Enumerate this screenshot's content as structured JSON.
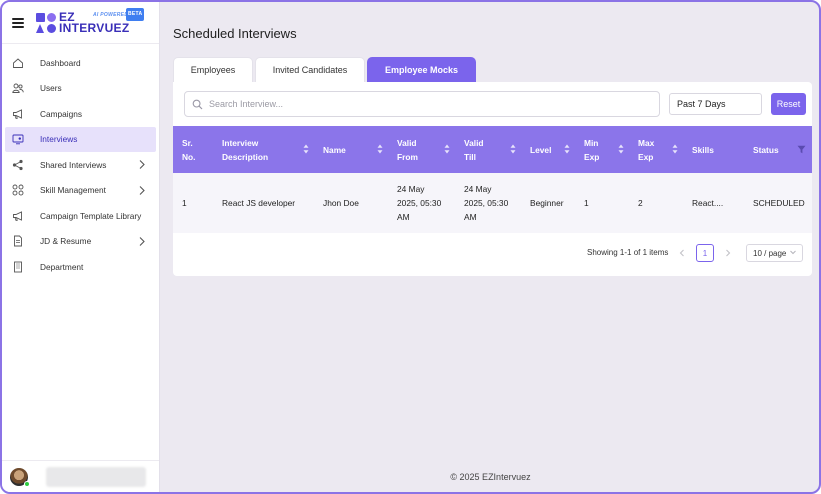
{
  "brand": {
    "line1": "EZ",
    "line2": "INTERVUEZ",
    "tagline": "AI POWERED",
    "badge": "BETA",
    "color": "#3a2fb8"
  },
  "sidebar": {
    "items": [
      {
        "label": "Dashboard",
        "icon": "home-icon"
      },
      {
        "label": "Users",
        "icon": "users-icon"
      },
      {
        "label": "Campaigns",
        "icon": "megaphone-icon"
      },
      {
        "label": "Interviews",
        "icon": "monitor-user-icon",
        "active": true
      },
      {
        "label": "Shared Interviews",
        "icon": "share-icon",
        "expandable": true
      },
      {
        "label": "Skill Management",
        "icon": "apps-icon",
        "expandable": true
      },
      {
        "label": "Campaign Template Library",
        "icon": "megaphone-icon"
      },
      {
        "label": "JD & Resume",
        "icon": "document-icon",
        "expandable": true
      },
      {
        "label": "Department",
        "icon": "building-icon"
      }
    ]
  },
  "page": {
    "title": "Scheduled Interviews"
  },
  "tabs": [
    {
      "label": "Employees"
    },
    {
      "label": "Invited Candidates"
    },
    {
      "label": "Employee Mocks",
      "active": true
    }
  ],
  "filters": {
    "search_placeholder": "Search Interview...",
    "date_range": "Past 7 Days",
    "reset_label": "Reset"
  },
  "table": {
    "columns": [
      {
        "label": "Sr.\nNo.",
        "sortable": false
      },
      {
        "label": "Interview\nDescription",
        "sortable": true
      },
      {
        "label": "Name",
        "sortable": true
      },
      {
        "label": "Valid\nFrom",
        "sortable": true
      },
      {
        "label": "Valid\nTill",
        "sortable": true
      },
      {
        "label": "Level",
        "sortable": true
      },
      {
        "label": "Min\nExp",
        "sortable": true
      },
      {
        "label": "Max\nExp",
        "sortable": true
      },
      {
        "label": "Skills",
        "sortable": false
      },
      {
        "label": "Status",
        "filter": true
      }
    ],
    "rows": [
      [
        "1",
        "React JS developer",
        "Jhon Doe",
        "24 May\n2025, 05:30\nAM",
        "24 May\n2025, 05:30\nAM",
        "Beginner",
        "1",
        "2",
        "React....",
        "SCHEDULED"
      ]
    ]
  },
  "pagination": {
    "summary": "Showing 1-1 of 1 items",
    "current_page": "1",
    "page_size": "10 / page"
  },
  "footer": {
    "copyright": "© 2025 EZIntervuez"
  },
  "colors": {
    "accent": "#7b64ec",
    "header_bg": "#8b75ea",
    "page_bg": "#ece9f1"
  }
}
